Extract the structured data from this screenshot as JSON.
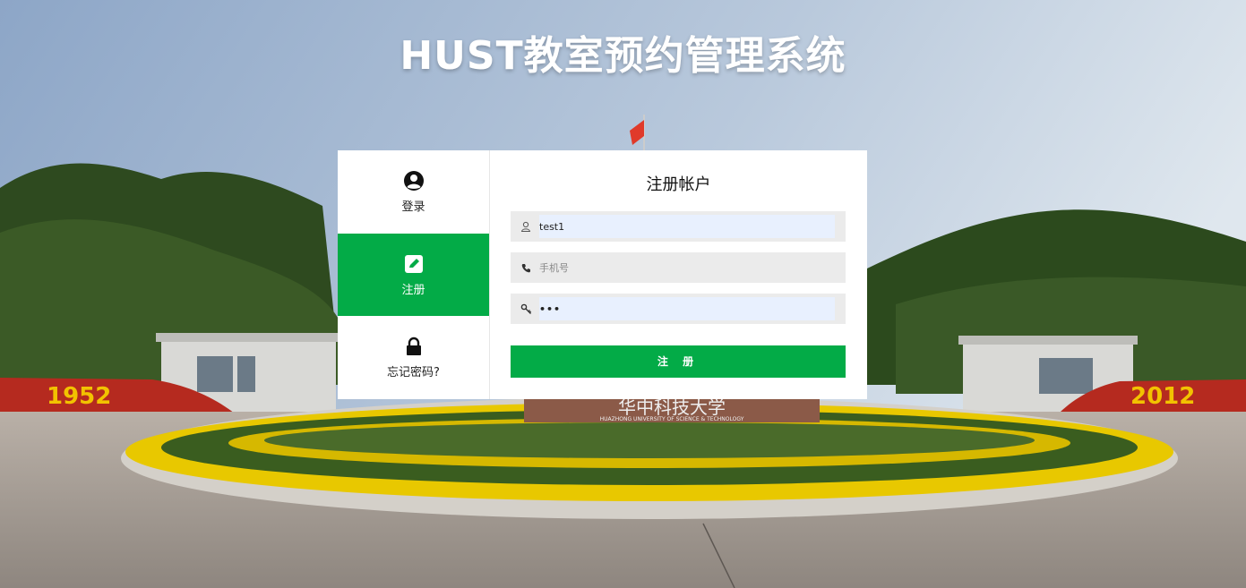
{
  "header": {
    "title": "HUST教室预约管理系统"
  },
  "tabs": [
    {
      "label": "登录",
      "icon": "user-circle-icon"
    },
    {
      "label": "注册",
      "icon": "edit-icon",
      "active": true
    },
    {
      "label": "忘记密码?",
      "icon": "lock-icon"
    }
  ],
  "form": {
    "title": "注册帐户",
    "username": {
      "value": "test1",
      "icon": "user-icon"
    },
    "phone": {
      "placeholder": "手机号",
      "icon": "phone-icon"
    },
    "password": {
      "value": "•••",
      "icon": "key-icon"
    },
    "submit_label": "注 册"
  },
  "background": {
    "left_flower_sign": "1952",
    "right_flower_sign": "2012",
    "campus_sign": "华中科技大学",
    "campus_sign_en": "HUAZHONG UNIVERSITY OF SCIENCE & TECHNOLOGY"
  },
  "colors": {
    "accent": "#03ab47"
  }
}
